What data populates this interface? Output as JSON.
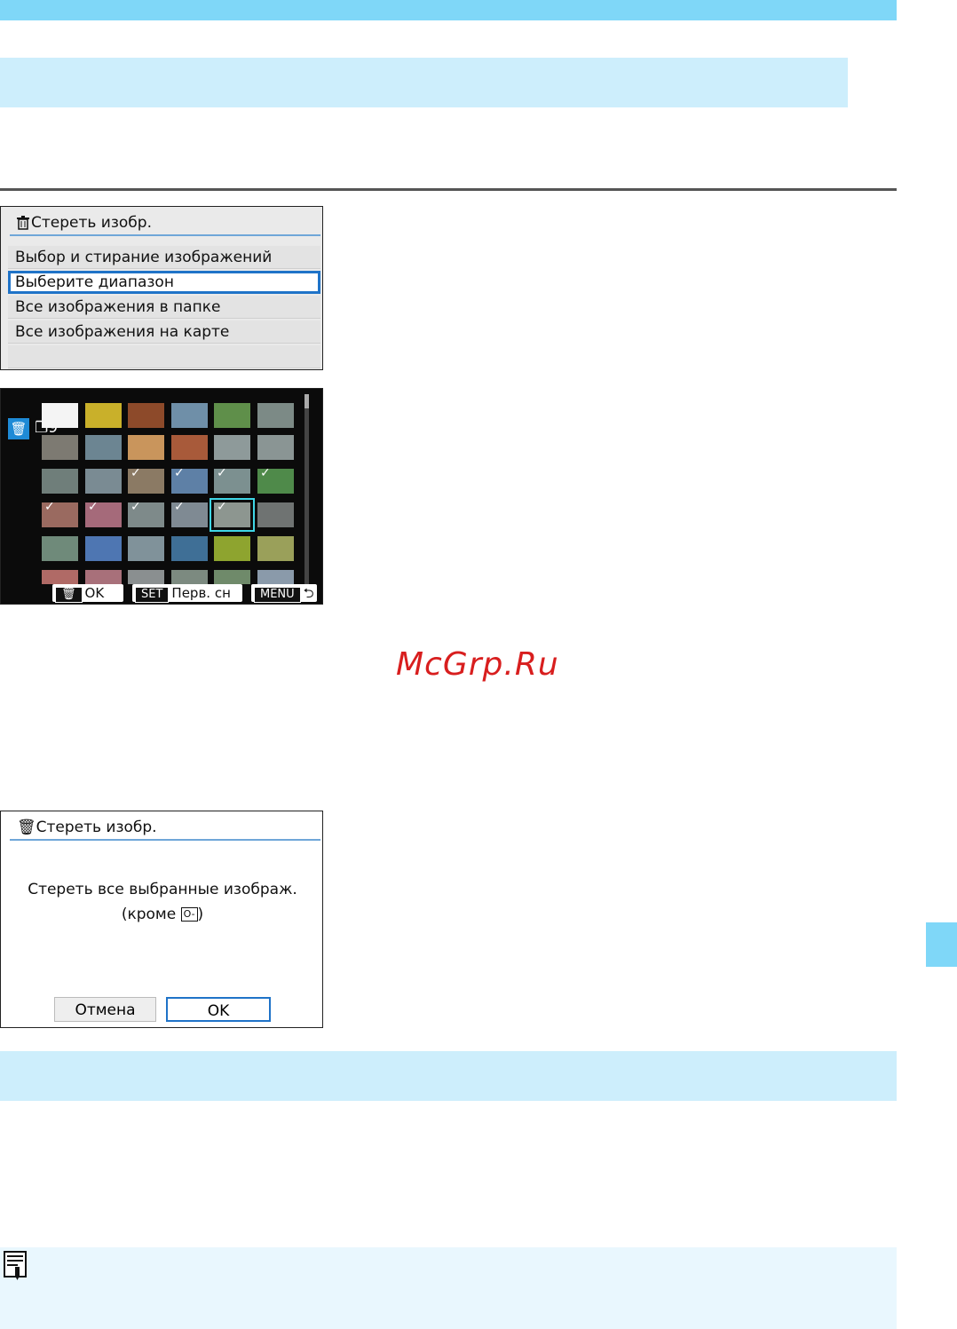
{
  "menu_screen": {
    "title": "Стереть изобр.",
    "items": [
      {
        "label": "Выбор и стирание изображений",
        "selected": false
      },
      {
        "label": "Выберите диапазон",
        "selected": true
      },
      {
        "label": "Все изображения в папке",
        "selected": false
      },
      {
        "label": "Все изображения на карте",
        "selected": false
      }
    ]
  },
  "grid_screen": {
    "count": "9",
    "buttons": {
      "ok_key": "OK",
      "set_key": "SET",
      "set_label": "Перв. сн",
      "menu_key": "MENU"
    },
    "thumbnails": [
      {
        "color": "#f4f4f4",
        "checked": false
      },
      {
        "color": "#c9b02a",
        "checked": false
      },
      {
        "color": "#8d4a2a",
        "checked": false
      },
      {
        "color": "#6f8fa8",
        "checked": false
      },
      {
        "color": "#5f8f4a",
        "checked": false
      },
      {
        "color": "#7c8a86",
        "checked": false
      },
      {
        "color": "#7d7a72",
        "checked": false
      },
      {
        "color": "#6c8592",
        "checked": false
      },
      {
        "color": "#c9955c",
        "checked": false
      },
      {
        "color": "#a85a3a",
        "checked": false
      },
      {
        "color": "#8e9a9a",
        "checked": false
      },
      {
        "color": "#8a9594",
        "checked": false
      },
      {
        "color": "#6f7e7a",
        "checked": false
      },
      {
        "color": "#7a8b93",
        "checked": false
      },
      {
        "color": "#8b7a64",
        "checked": true
      },
      {
        "color": "#5e80a6",
        "checked": true
      },
      {
        "color": "#7c9090",
        "checked": true
      },
      {
        "color": "#4f8a4a",
        "checked": true
      },
      {
        "color": "#9a6a60",
        "checked": true
      },
      {
        "color": "#a56a7a",
        "checked": true
      },
      {
        "color": "#7e8a8a",
        "checked": true
      },
      {
        "color": "#7f8a93",
        "checked": true
      },
      {
        "color": "#8d9690",
        "checked": true
      },
      {
        "color": "#6f7372",
        "checked": false
      },
      {
        "color": "#6f8a7a",
        "checked": false
      },
      {
        "color": "#4e76b2",
        "checked": false
      },
      {
        "color": "#80929a",
        "checked": false
      },
      {
        "color": "#3f6f96",
        "checked": false
      },
      {
        "color": "#8ea42f",
        "checked": false
      },
      {
        "color": "#9aa05a",
        "checked": false
      },
      {
        "color": "#b06a66",
        "checked": false
      },
      {
        "color": "#a8707a",
        "checked": false
      },
      {
        "color": "#8a8f90",
        "checked": false
      },
      {
        "color": "#7c8a80",
        "checked": false
      },
      {
        "color": "#6f8a6a",
        "checked": false
      },
      {
        "color": "#8a9aaa",
        "checked": false
      }
    ]
  },
  "watermark": "McGrp.Ru",
  "confirm_screen": {
    "title": "Стереть изобр.",
    "message_line1": "Стереть все выбранные изображ.",
    "message_line2_prefix": "(кроме",
    "message_line2_suffix": ")",
    "cancel_label": "Отмена",
    "ok_label": "OK"
  }
}
